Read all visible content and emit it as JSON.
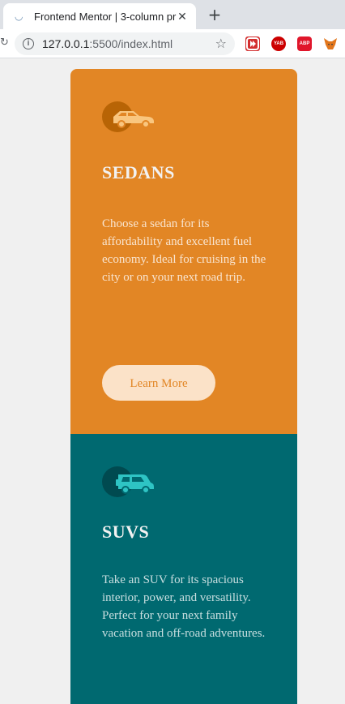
{
  "browser": {
    "tab_title": "Frontend Mentor | 3-column pr",
    "close_glyph": "✕",
    "new_tab_glyph": "+",
    "url_host": "127.0.0.1",
    "url_rest": ":5500/index.html",
    "extensions": [
      "YAB",
      "ABP"
    ]
  },
  "cards": {
    "sedans": {
      "title": "SEDANS",
      "body": "Choose a sedan for its affordability and excellent fuel economy. Ideal for cruising in the city or on your next road trip.",
      "button_label": "Learn More",
      "color": "#e28625"
    },
    "suvs": {
      "title": "SUVS",
      "body": "Take an SUV for its spacious interior, power, and versatility. Perfect for your next family vacation and off-road adventures.",
      "color": "#006970"
    }
  }
}
